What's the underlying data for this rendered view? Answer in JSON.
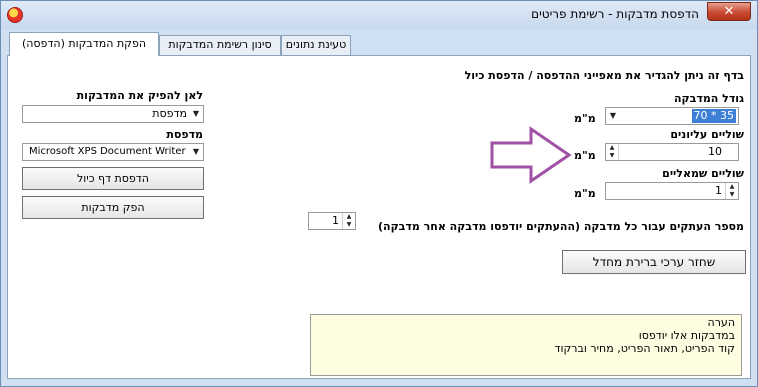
{
  "window": {
    "title": "הדפסת מדבקות - רשימת פריטים",
    "close_label": "✕"
  },
  "tabs": [
    {
      "label": "הפקת המדבקות (הדפסה)"
    },
    {
      "label": "סינון רשימת המדבקות"
    },
    {
      "label": "טעינת נתונים"
    }
  ],
  "main": {
    "intro": "בדף זה ניתן להגדיר את מאפייני ההדפסה / הדפסת כיול",
    "size_label": "גודל המדבקה",
    "size_value": "70 * 35",
    "size_unit": "מ\"מ",
    "top_margin_label": "שוליים עליונים",
    "top_margin_value": "10",
    "top_margin_unit": "מ\"מ",
    "left_margin_label": "שוליים שמאליים",
    "left_margin_value": "1",
    "left_margin_unit": "מ\"מ",
    "copies_label": "מספר העתקים עבור כל מדבקה (ההעתקים יודפסו מדבקה אחר מדבקה)",
    "copies_value": "1",
    "reset_button": "שחזר ערכי ברירת מחדל"
  },
  "output": {
    "target_label": "לאן להפיק את המדבקות",
    "target_value": "מדפסת",
    "printer_label": "מדפסת",
    "printer_value": "Microsoft XPS Document Writer",
    "print_calibration_button": "הדפסת דף כיול",
    "produce_labels_button": "הפק מדבקות"
  },
  "note": {
    "title": "הערה",
    "line1": "במדבקות אלו יודפסו",
    "line2": "קוד הפריט, תאור הפריט, מחיר וברקוד"
  },
  "annotation": {
    "arrow_color": "#a051a6"
  },
  "colors": {
    "window_bg": "#cfe0f3",
    "selection": "#3d7fd6",
    "close": "#c84a32"
  }
}
